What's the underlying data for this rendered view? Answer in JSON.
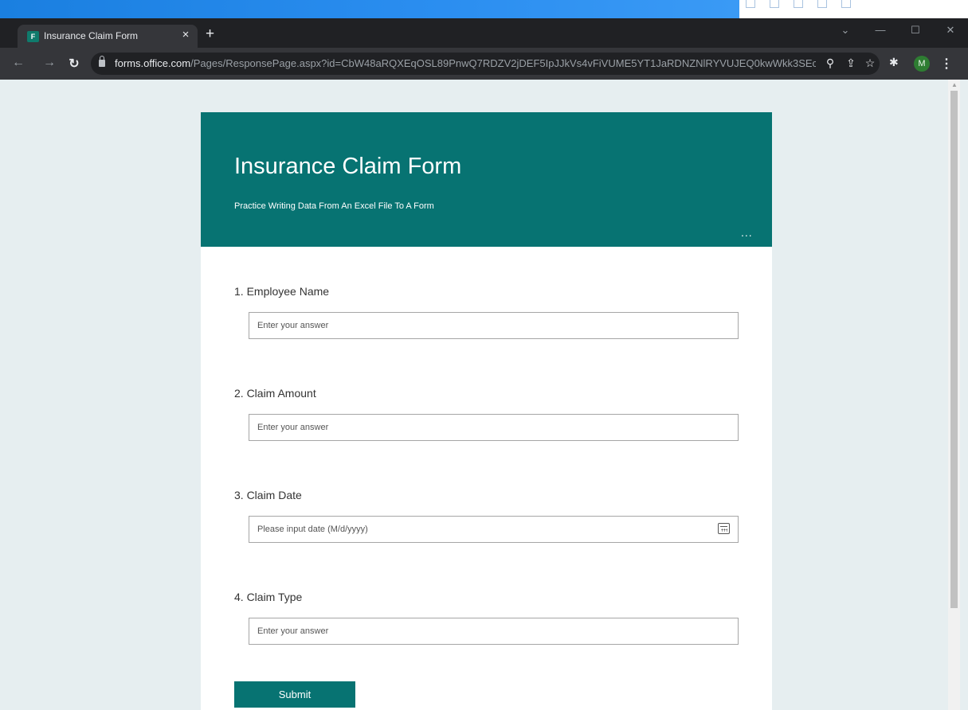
{
  "browser": {
    "tab_title": "Insurance Claim Form",
    "tab_close": "×",
    "new_tab": "+",
    "url_host": "forms.office.com",
    "url_path": "/Pages/ResponsePage.aspx?id=CbW48aRQXEqOSL89PnwQ7RDZV2jDEF5IpJJkVs4vFiVUME5YT1JaRDNZNlRYVUJEQ0kwWkk3SEc2Wi...",
    "profile_initial": "M",
    "icons": [
      "favicon-forms",
      "back-icon",
      "forward-icon",
      "reload-icon",
      "lock-icon",
      "zoom-icon",
      "share-icon",
      "star-icon",
      "extensions-icon",
      "menu-icon"
    ]
  },
  "form": {
    "title": "Insurance Claim Form",
    "subtitle": "Practice Writing Data From An Excel File To A Form",
    "more": "...",
    "accent_color": "#077372",
    "questions": [
      {
        "label": "1. Employee Name",
        "placeholder": "Enter your answer",
        "value": ""
      },
      {
        "label": "2. Claim Amount",
        "placeholder": "Enter your answer",
        "value": ""
      },
      {
        "label": "3. Claim Date",
        "placeholder": "Please input date (M/d/yyyy)",
        "value": ""
      },
      {
        "label": "4. Claim Type",
        "placeholder": "Enter your answer",
        "value": ""
      }
    ],
    "submit_label": "Submit"
  }
}
